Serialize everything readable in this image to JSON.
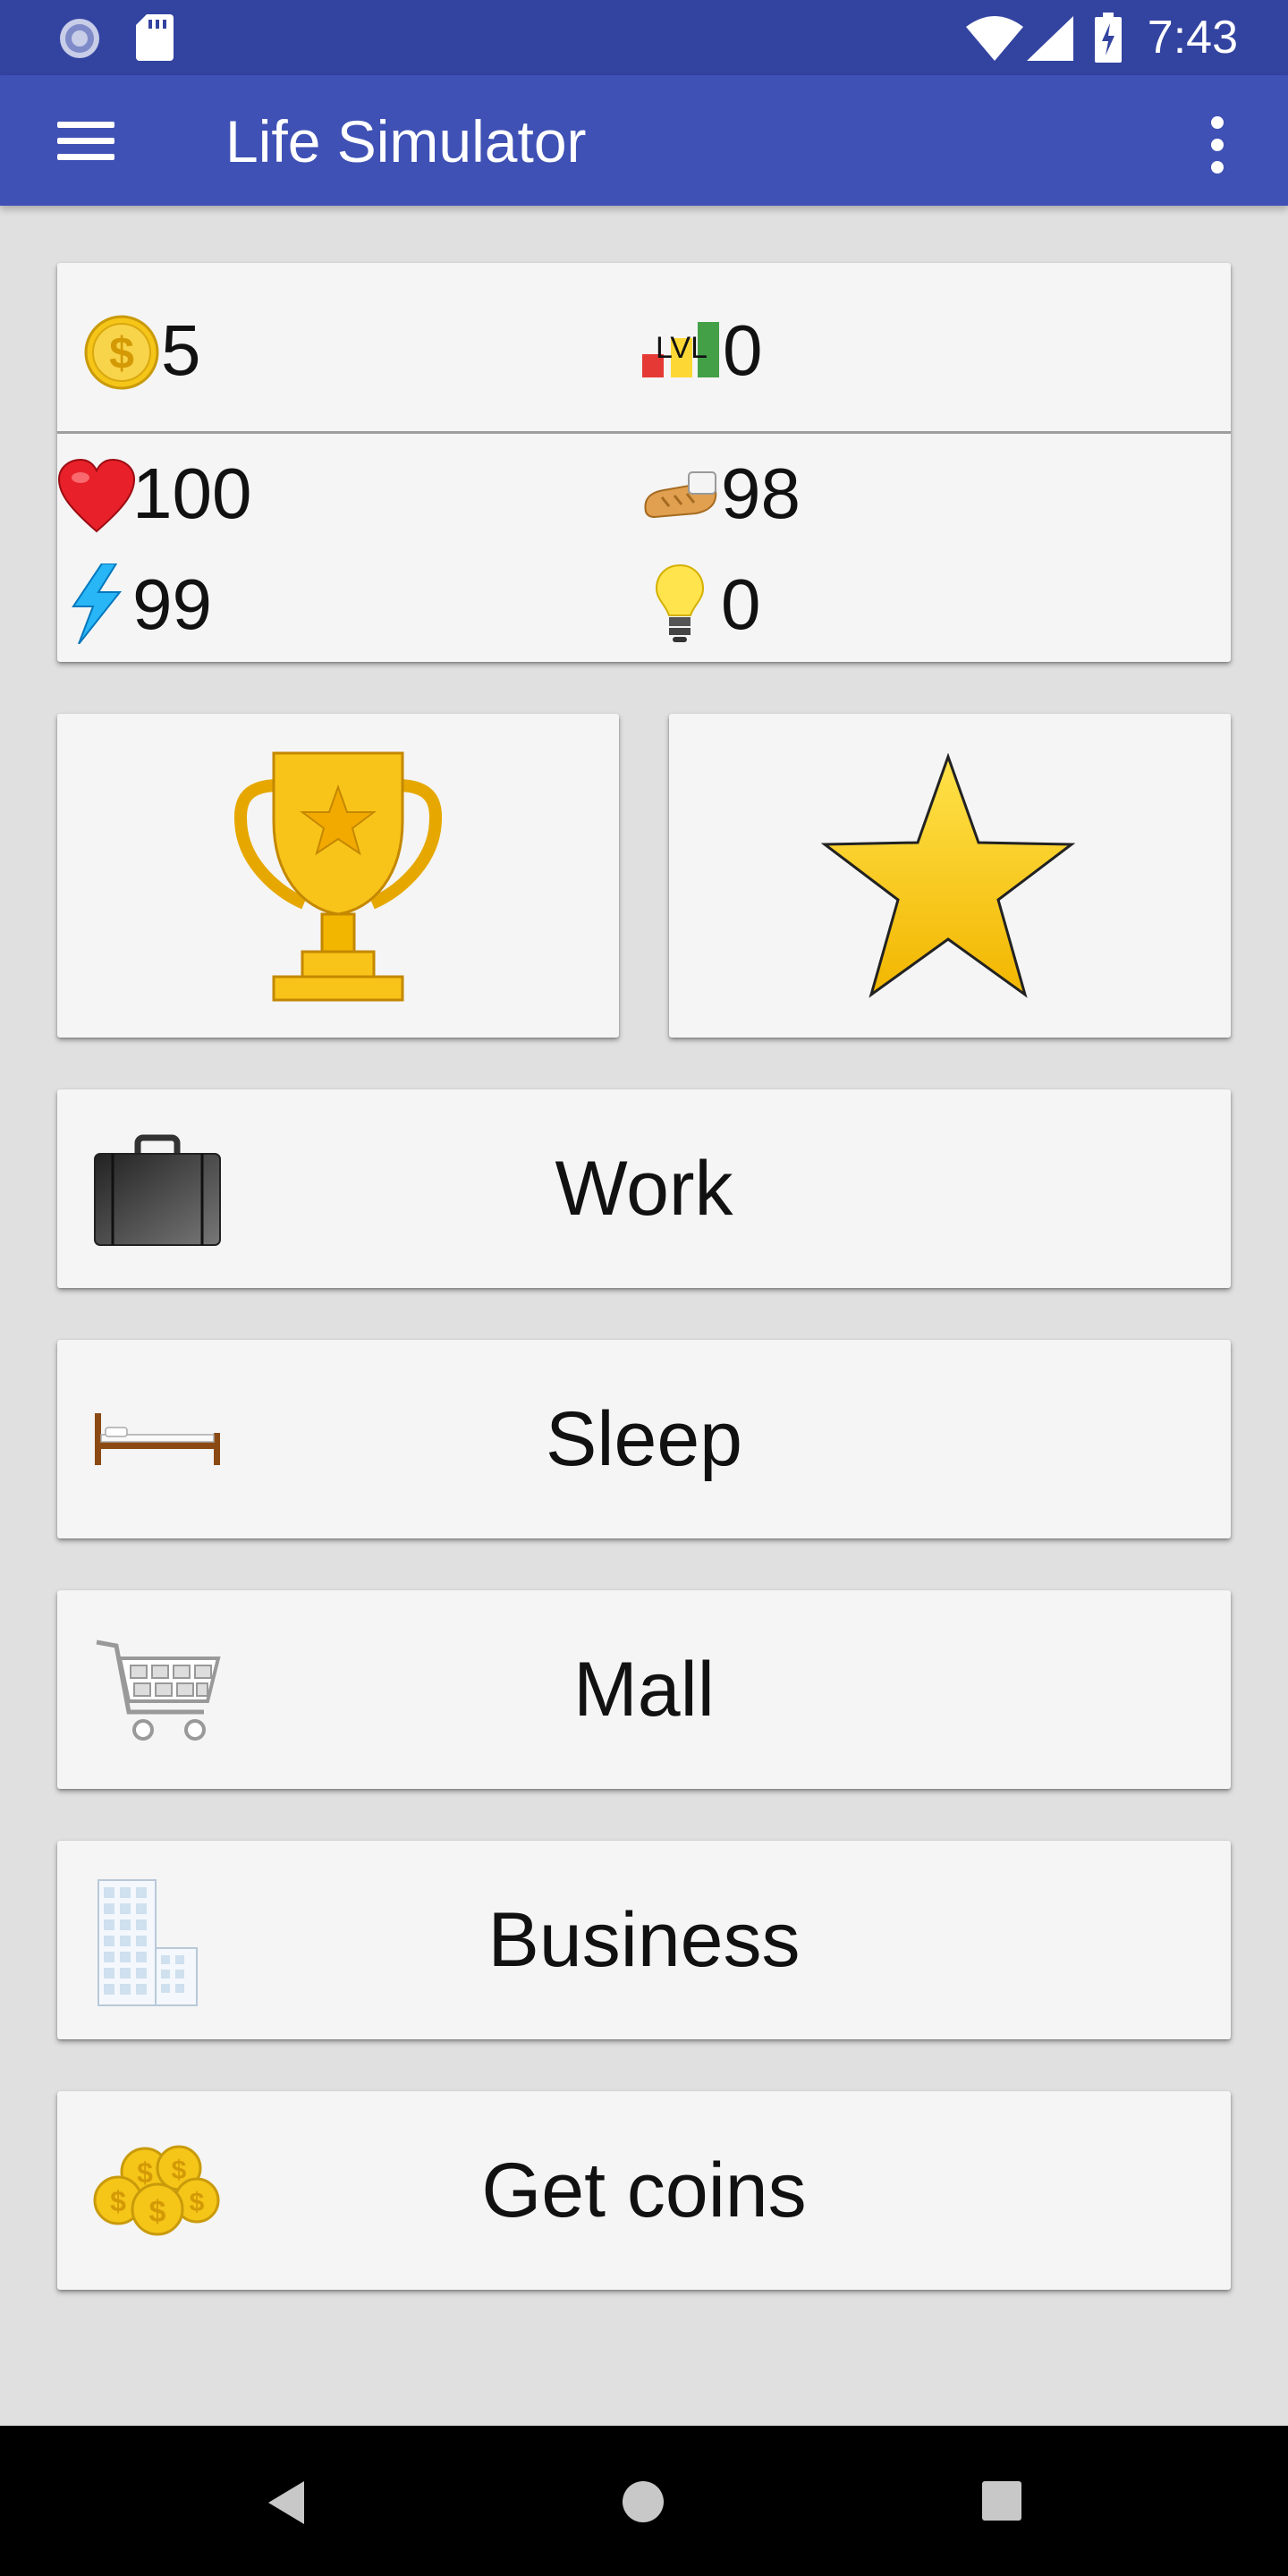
{
  "status_bar": {
    "time": "7:43"
  },
  "app_bar": {
    "title": "Life Simulator"
  },
  "stats": {
    "money": "5",
    "level_icon_text": "LVL",
    "level": "0",
    "health": "100",
    "food": "98",
    "energy": "99",
    "ideas": "0"
  },
  "actions": [
    {
      "label": "Work",
      "icon": "briefcase-icon"
    },
    {
      "label": "Sleep",
      "icon": "bed-icon"
    },
    {
      "label": "Mall",
      "icon": "shopping-cart-icon"
    },
    {
      "label": "Business",
      "icon": "building-icon"
    },
    {
      "label": "Get coins",
      "icon": "coins-icon"
    }
  ],
  "colors": {
    "status_bar": "#3343a0",
    "app_bar": "#3f51b5",
    "background": "#e0e0e0",
    "card": "#f5f5f5",
    "gold": "#f5c518"
  }
}
